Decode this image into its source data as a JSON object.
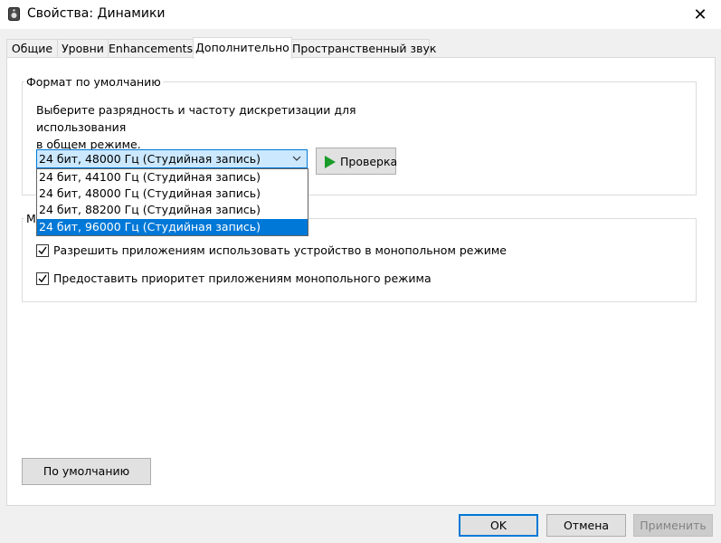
{
  "window": {
    "title": "Свойства: Динамики",
    "close_glyph": "✕"
  },
  "tabs": [
    {
      "label": "Общие"
    },
    {
      "label": "Уровни"
    },
    {
      "label": "Enhancements"
    },
    {
      "label": "Дополнительно",
      "active": true
    },
    {
      "label": "Пространственный звук"
    }
  ],
  "default_format": {
    "group_label": "Формат по умолчанию",
    "description_line1": "Выберите разрядность и частоту дискретизации для использования",
    "description_line2": "в общем режиме.",
    "selected_value": "24 бит, 48000 Гц (Студийная запись)",
    "options": [
      "24 бит, 44100 Гц (Студийная запись)",
      "24 бит, 48000 Гц (Студийная запись)",
      "24 бит, 88200 Гц (Студийная запись)",
      "24 бит, 96000 Гц (Студийная запись)"
    ],
    "highlighted_option_index": 3,
    "test_button": "Проверка"
  },
  "exclusive_mode": {
    "group_label_visible": "М",
    "allow_exclusive": {
      "label": "Разрешить приложениям использовать устройство в монопольном режиме",
      "checked": true
    },
    "give_priority": {
      "label": "Предоставить приоритет приложениям монопольного режима",
      "checked": true
    }
  },
  "restore_defaults_button": "По умолчанию",
  "footer": {
    "ok": "OK",
    "cancel": "Отмена",
    "apply": "Применить"
  },
  "colors": {
    "accent": "#0078d7",
    "combo_highlight": "#cce8ff",
    "play_green": "#1a9c2a"
  }
}
